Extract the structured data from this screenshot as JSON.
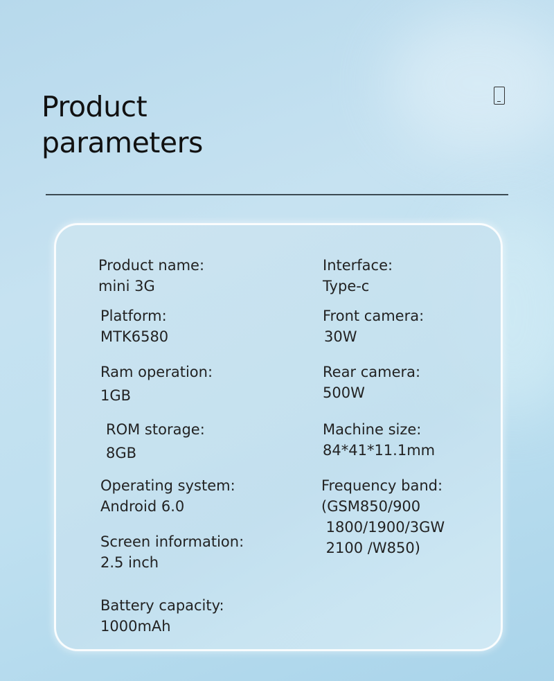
{
  "title": {
    "line1": "Product",
    "line2": "parameters"
  },
  "icon": "phone-icon",
  "specs_left": [
    {
      "key": "product-name",
      "label": "Product name:",
      "value": "mini 3G"
    },
    {
      "key": "platform",
      "label": "Platform:",
      "value": "MTK6580"
    },
    {
      "key": "ram",
      "label": "Ram operation:",
      "value": "1GB"
    },
    {
      "key": "rom",
      "label": "ROM storage:",
      "value": "8GB"
    },
    {
      "key": "os",
      "label": "Operating system:",
      "value": "Android 6.0"
    },
    {
      "key": "screen",
      "label": "Screen information:",
      "value": "2.5 inch"
    },
    {
      "key": "battery",
      "label": "Battery capacity:",
      "value": "1000mAh"
    }
  ],
  "specs_right": [
    {
      "key": "interface",
      "label": "Interface:",
      "value": "Type-c"
    },
    {
      "key": "front-camera",
      "label": "Front camera:",
      "value": "30W"
    },
    {
      "key": "rear-camera",
      "label": "Rear camera:",
      "value": "500W"
    },
    {
      "key": "machine-size",
      "label": "Machine size:",
      "value": "84*41*11.1mm"
    },
    {
      "key": "frequency-band",
      "label": "Frequency band:",
      "value": "(GSM850/900",
      "value2": " 1800/1900/3GW",
      "value3": " 2100 /W850)"
    }
  ]
}
